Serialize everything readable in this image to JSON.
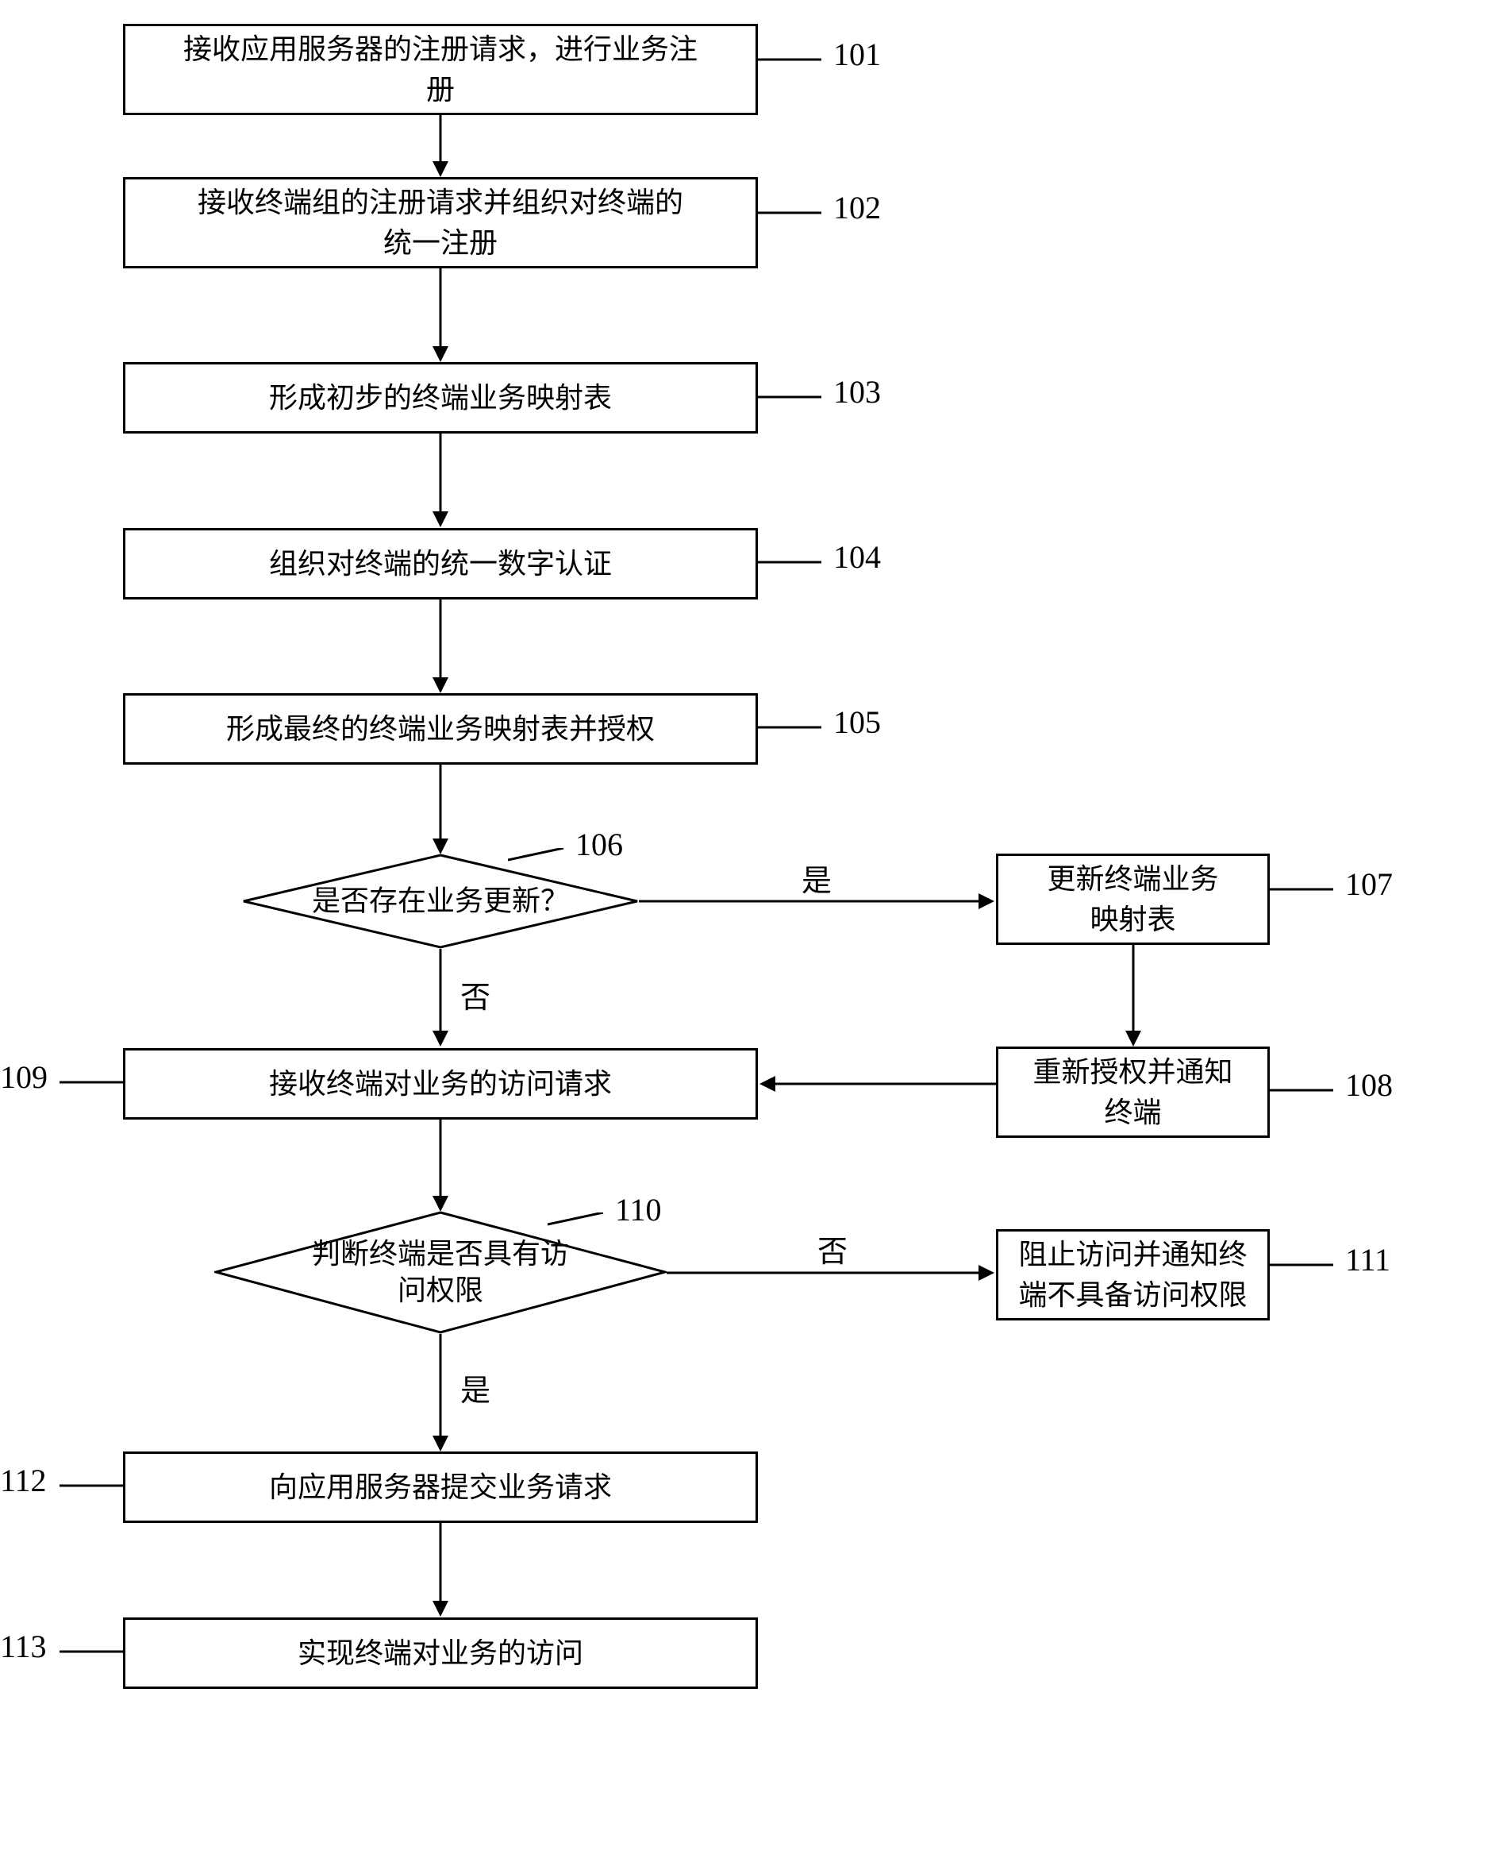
{
  "nodes": {
    "n101": "接收应用服务器的注册请求，进行业务注\n册",
    "n102": "接收终端组的注册请求并组织对终端的\n统一注册",
    "n103": "形成初步的终端业务映射表",
    "n104": "组织对终端的统一数字认证",
    "n105": "形成最终的终端业务映射表并授权",
    "n106": "是否存在业务更新？",
    "n107": "更新终端业务\n映射表",
    "n108": "重新授权并通知\n终端",
    "n109": "接收终端对业务的访问请求",
    "n110": "判断终端是否具有访\n问权限",
    "n111": "阻止访问并通知终\n端不具备访问权限",
    "n112": "向应用服务器提交业务请求",
    "n113": "实现终端对业务的访问"
  },
  "labels": {
    "l101": "101",
    "l102": "102",
    "l103": "103",
    "l104": "104",
    "l105": "105",
    "l106": "106",
    "l107": "107",
    "l108": "108",
    "l109": "109",
    "l110": "110",
    "l111": "111",
    "l112": "112",
    "l113": "113"
  },
  "edges": {
    "yes": "是",
    "no": "否"
  },
  "chart_data": {
    "type": "flowchart",
    "nodes": [
      {
        "id": "101",
        "shape": "rect",
        "text": "接收应用服务器的注册请求，进行业务注册"
      },
      {
        "id": "102",
        "shape": "rect",
        "text": "接收终端组的注册请求并组织对终端的统一注册"
      },
      {
        "id": "103",
        "shape": "rect",
        "text": "形成初步的终端业务映射表"
      },
      {
        "id": "104",
        "shape": "rect",
        "text": "组织对终端的统一数字认证"
      },
      {
        "id": "105",
        "shape": "rect",
        "text": "形成最终的终端业务映射表并授权"
      },
      {
        "id": "106",
        "shape": "diamond",
        "text": "是否存在业务更新？"
      },
      {
        "id": "107",
        "shape": "rect",
        "text": "更新终端业务映射表"
      },
      {
        "id": "108",
        "shape": "rect",
        "text": "重新授权并通知终端"
      },
      {
        "id": "109",
        "shape": "rect",
        "text": "接收终端对业务的访问请求"
      },
      {
        "id": "110",
        "shape": "diamond",
        "text": "判断终端是否具有访问权限"
      },
      {
        "id": "111",
        "shape": "rect",
        "text": "阻止访问并通知终端不具备访问权限"
      },
      {
        "id": "112",
        "shape": "rect",
        "text": "向应用服务器提交业务请求"
      },
      {
        "id": "113",
        "shape": "rect",
        "text": "实现终端对业务的访问"
      }
    ],
    "edges": [
      {
        "from": "101",
        "to": "102"
      },
      {
        "from": "102",
        "to": "103"
      },
      {
        "from": "103",
        "to": "104"
      },
      {
        "from": "104",
        "to": "105"
      },
      {
        "from": "105",
        "to": "106"
      },
      {
        "from": "106",
        "to": "107",
        "label": "是"
      },
      {
        "from": "106",
        "to": "109",
        "label": "否"
      },
      {
        "from": "107",
        "to": "108"
      },
      {
        "from": "108",
        "to": "109"
      },
      {
        "from": "109",
        "to": "110"
      },
      {
        "from": "110",
        "to": "111",
        "label": "否"
      },
      {
        "from": "110",
        "to": "112",
        "label": "是"
      },
      {
        "from": "112",
        "to": "113"
      }
    ]
  }
}
